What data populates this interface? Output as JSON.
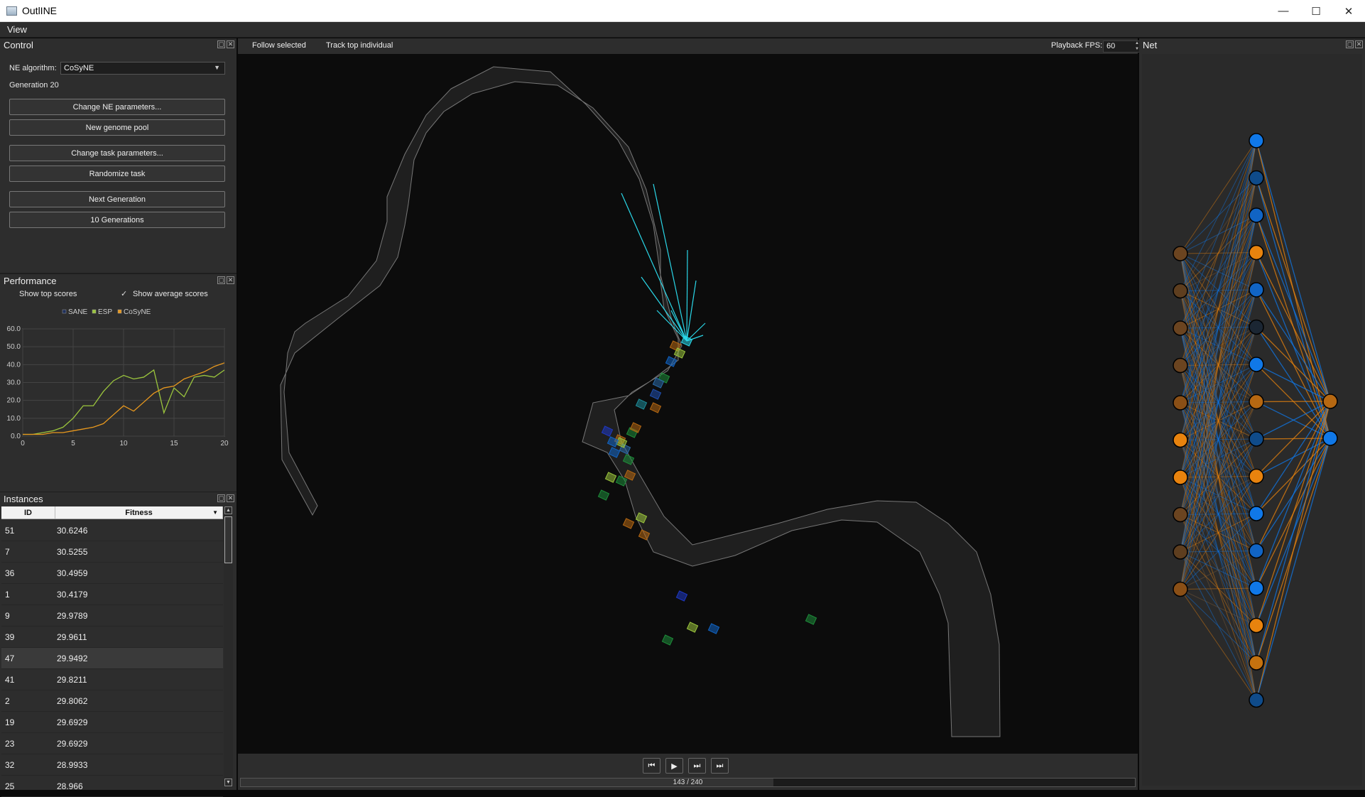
{
  "window": {
    "title": "OutlINE"
  },
  "menu": {
    "view": "View"
  },
  "control": {
    "title": "Control",
    "algorithm_label": "NE algorithm:",
    "algorithm_value": "CoSyNE",
    "generation": "Generation 20",
    "buttons": {
      "change_ne": "Change NE parameters...",
      "new_pool": "New genome pool",
      "change_task": "Change task parameters...",
      "randomize": "Randomize task",
      "next_gen": "Next Generation",
      "ten_gen": "10 Generations"
    }
  },
  "performance": {
    "title": "Performance",
    "show_top_label": "Show top scores",
    "show_top_checked": false,
    "show_avg_label": "Show average scores",
    "show_avg_checked": true,
    "check_mark": "✓"
  },
  "chart_data": {
    "type": "line",
    "xlim": [
      0,
      20
    ],
    "ylim": [
      0,
      60
    ],
    "x_ticks": [
      "0",
      "5",
      "10",
      "15",
      "20"
    ],
    "y_ticks": [
      "0.0",
      "10.0",
      "20.0",
      "30.0",
      "40.0",
      "50.0",
      "60.0"
    ],
    "grid": true,
    "legend_position": "top",
    "series": [
      {
        "name": "SANE",
        "color": "#1e2f5a",
        "x": [],
        "y": []
      },
      {
        "name": "ESP",
        "color": "#9bc53d",
        "x": [
          0,
          1,
          2,
          3,
          4,
          5,
          6,
          7,
          8,
          9,
          10,
          11,
          12,
          13,
          14,
          15,
          16,
          17,
          18,
          19,
          20
        ],
        "y": [
          1,
          1,
          2,
          3,
          5,
          10,
          17,
          17,
          25,
          31,
          34,
          32,
          33,
          37,
          13,
          27,
          22,
          33,
          34,
          33,
          37
        ]
      },
      {
        "name": "CoSyNE",
        "color": "#e8981e",
        "x": [
          0,
          1,
          2,
          3,
          4,
          5,
          6,
          7,
          8,
          9,
          10,
          11,
          12,
          13,
          14,
          15,
          16,
          17,
          18,
          19,
          20
        ],
        "y": [
          1,
          1,
          1,
          2,
          2,
          3,
          4,
          5,
          7,
          12,
          17,
          14,
          19,
          24,
          27,
          28,
          32,
          34,
          36,
          39,
          41
        ]
      }
    ]
  },
  "instances": {
    "title": "Instances",
    "col_id": "ID",
    "col_fitness": "Fitness",
    "sort_icon": "▼",
    "rows": [
      {
        "id": "51",
        "fitness": "30.6246"
      },
      {
        "id": "7",
        "fitness": "30.5255"
      },
      {
        "id": "36",
        "fitness": "30.4959"
      },
      {
        "id": "1",
        "fitness": "30.4179"
      },
      {
        "id": "9",
        "fitness": "29.9789"
      },
      {
        "id": "39",
        "fitness": "29.9611"
      },
      {
        "id": "47",
        "fitness": "29.9492"
      },
      {
        "id": "41",
        "fitness": "29.8211"
      },
      {
        "id": "2",
        "fitness": "29.8062"
      },
      {
        "id": "19",
        "fitness": "29.6929"
      },
      {
        "id": "23",
        "fitness": "29.6929"
      },
      {
        "id": "32",
        "fitness": "28.9933"
      },
      {
        "id": "25",
        "fitness": "28.966"
      }
    ],
    "selected_index": 6
  },
  "toolbar": {
    "follow_selected": "Follow selected",
    "track_top": "Track top individual",
    "fps_label": "Playback FPS:",
    "fps_value": "60"
  },
  "playback": {
    "progress_text": "143 / 240",
    "current": 143,
    "total": 240
  },
  "net": {
    "title": "Net",
    "input_colors": [
      "#6b4420",
      "#5e3e1f",
      "#6b4420",
      "#6b4420",
      "#8a4f16",
      "#e8830e",
      "#e8830e",
      "#6b4420",
      "#5e3e1f",
      "#8a4f16"
    ],
    "hidden_colors": [
      "#1078e8",
      "#0f4b8a",
      "#1164c4",
      "#e8830e",
      "#1164c4",
      "#1b2633",
      "#1078e8",
      "#b66812",
      "#0f4b8a",
      "#e8830e",
      "#1078e8",
      "#1164c4",
      "#1078e8",
      "#e8830e",
      "#c4720f",
      "#0f4b8a"
    ],
    "output_colors": [
      "#b66812",
      "#1078e8"
    ]
  },
  "colors": {
    "accent_blue": "#1078e8",
    "accent_orange": "#e8830e",
    "sensor_cyan": "#2ad7e8"
  }
}
